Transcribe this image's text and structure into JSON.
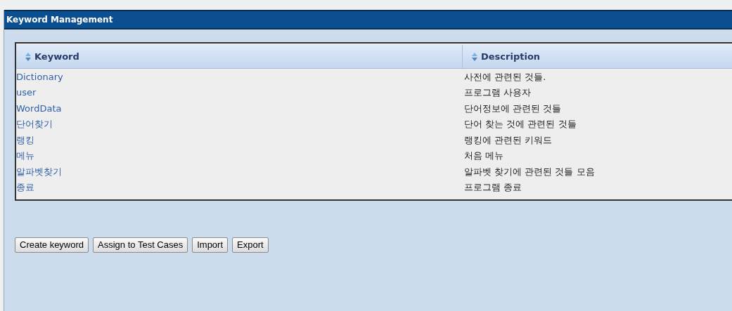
{
  "panel": {
    "title": "Keyword Management"
  },
  "table": {
    "columns": [
      "Keyword",
      "Description"
    ],
    "rows": [
      {
        "keyword": "Dictionary",
        "description": "사전에 관련된 것들."
      },
      {
        "keyword": "user",
        "description": "프로그램 사용자"
      },
      {
        "keyword": "WordData",
        "description": "단어정보에 관련된 것들"
      },
      {
        "keyword": "단어찾기",
        "description": "단어 찾는 것에 관련된 것들"
      },
      {
        "keyword": "랭킹",
        "description": "랭킹에 관련된 키워드"
      },
      {
        "keyword": "메뉴",
        "description": "처음 메뉴"
      },
      {
        "keyword": "알파벳찾기",
        "description": "알파벳 찾기에 관련된 것들 모음"
      },
      {
        "keyword": "종료",
        "description": "프로그램 종료"
      }
    ]
  },
  "buttons": [
    "Create keyword",
    "Assign to Test Cases",
    "Import",
    "Export"
  ]
}
